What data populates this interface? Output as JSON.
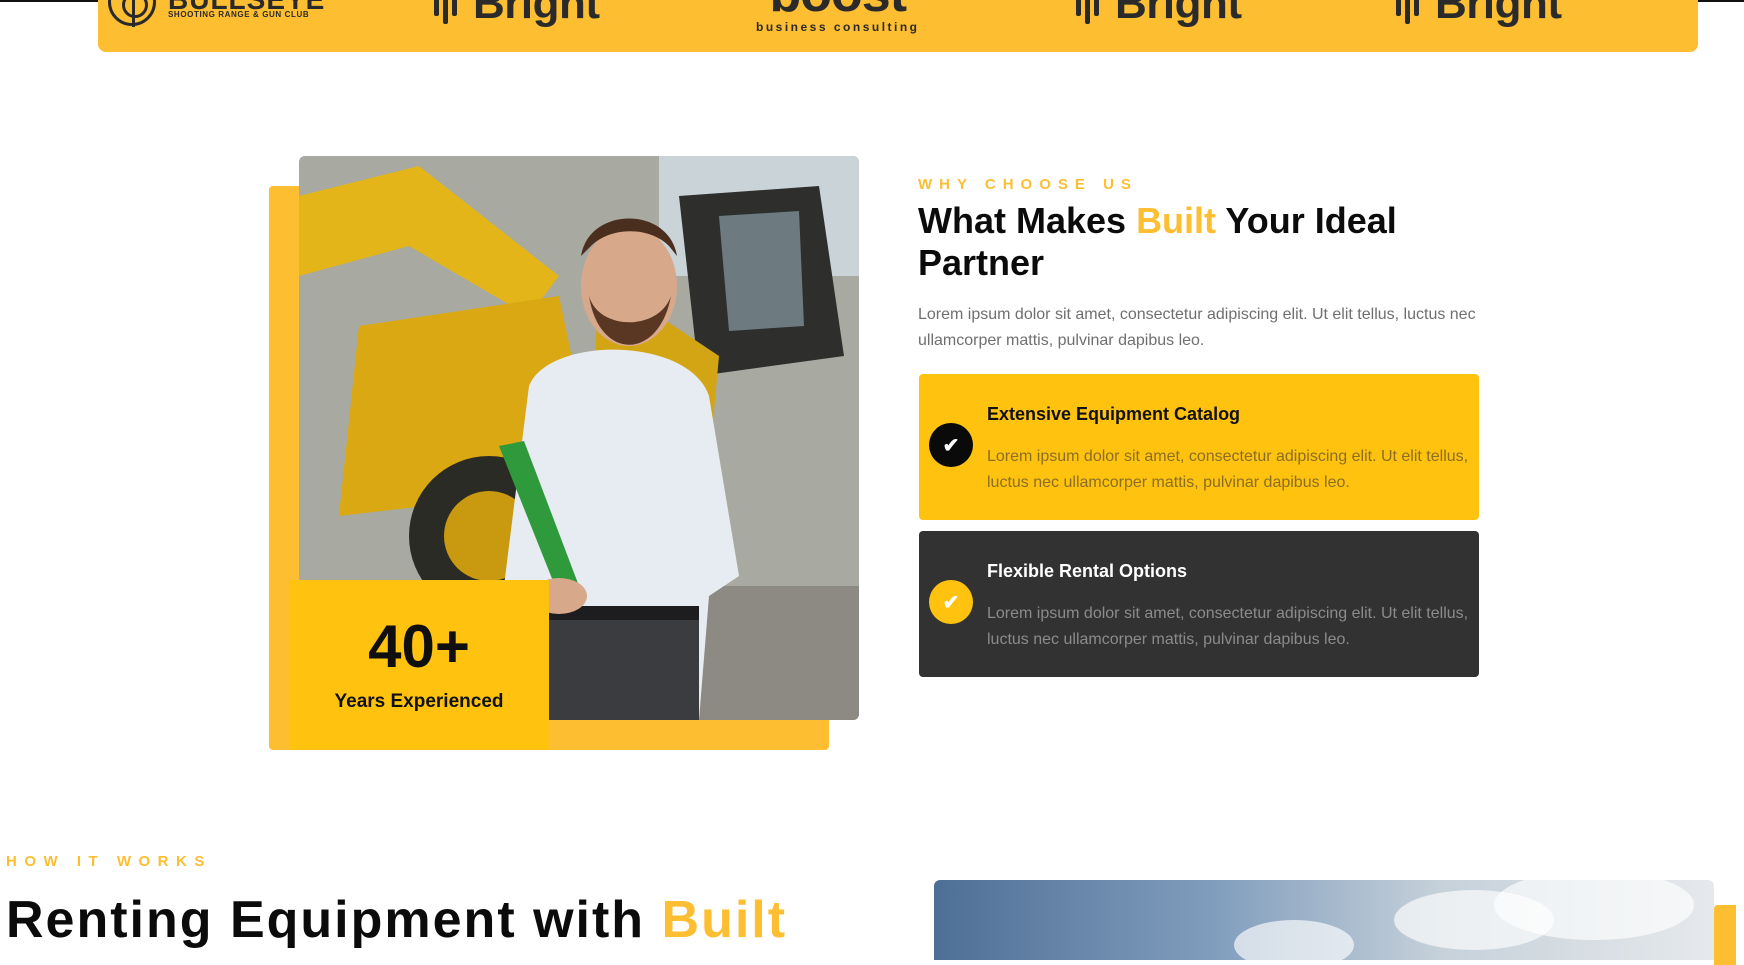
{
  "partner_logos": [
    {
      "name": "BULLSEYE",
      "tagline": "SHOOTING RANGE & GUN CLUB"
    },
    {
      "name": "Bright"
    },
    {
      "name": "boost",
      "tagline": "business consulting"
    },
    {
      "name": "Bright"
    },
    {
      "name": "Bright"
    }
  ],
  "why_choose": {
    "eyebrow": "WHY CHOOSE US",
    "title_part1": "What Makes ",
    "title_accent": "Built",
    "title_part2": " Your Ideal Partner",
    "description": "Lorem ipsum dolor sit amet, consectetur adipiscing elit. Ut elit tellus, luctus nec ullamcorper mattis, pulvinar dapibus leo.",
    "stat": {
      "value": "40+",
      "label": "Years Experienced"
    },
    "features": [
      {
        "title": "Extensive Equipment Catalog",
        "text": "Lorem ipsum dolor sit amet, consectetur adipiscing elit. Ut elit tellus, luctus nec ullamcorper mattis, pulvinar dapibus leo.",
        "icon": "check-icon"
      },
      {
        "title": "Flexible Rental Options",
        "text": "Lorem ipsum dolor sit amet, consectetur adipiscing elit. Ut elit tellus, luctus nec ullamcorper mattis, pulvinar dapibus leo.",
        "icon": "check-icon"
      }
    ]
  },
  "how_it_works": {
    "eyebrow": "HOW IT WORKS",
    "title_part1": "Renting Equipment with ",
    "title_accent": "Built"
  },
  "colors": {
    "accent": "#FDBE32",
    "card_yellow": "#FFC20E",
    "card_dark": "#323232"
  }
}
